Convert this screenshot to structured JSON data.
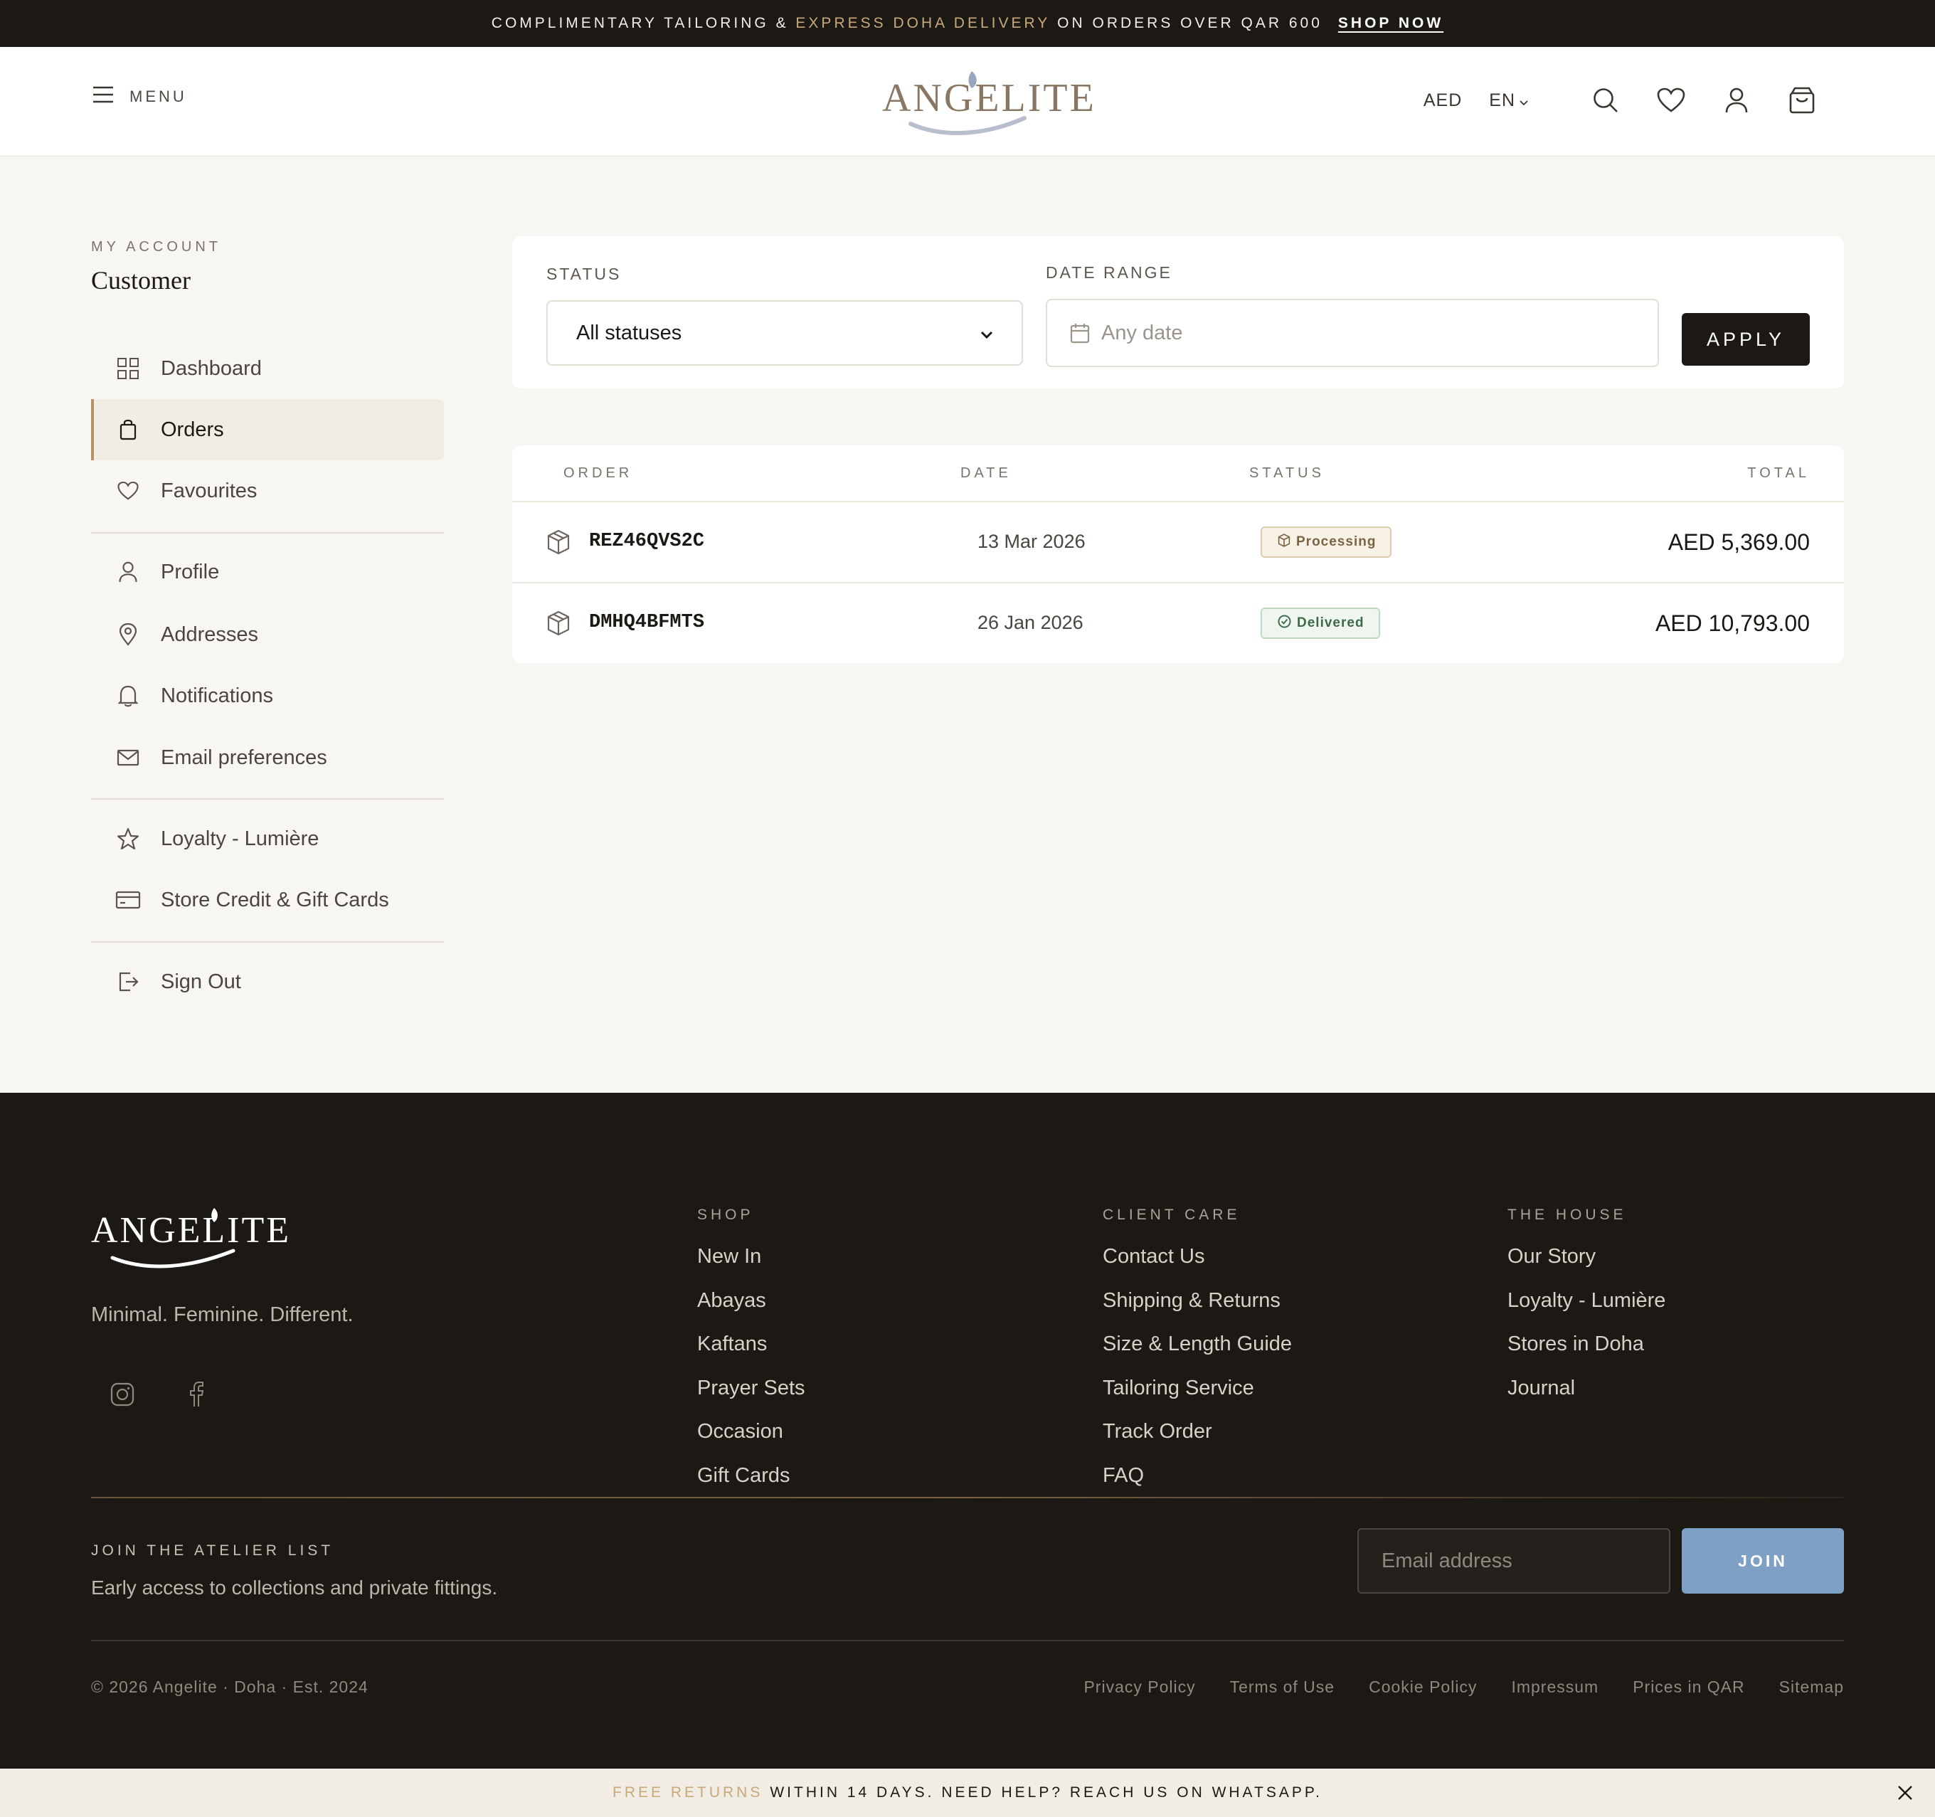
{
  "announcement": {
    "text_before": "COMPLIMENTARY TAILORING & ",
    "highlight": "EXPRESS DOHA DELIVERY",
    "text_after": " ON ORDERS OVER QAR 600",
    "cta": "SHOP NOW"
  },
  "header": {
    "menu_label": "MENU",
    "brand": "ANGELITE",
    "currency": "AED",
    "language": "EN",
    "icons": [
      "search-icon",
      "heart-icon",
      "user-icon",
      "bag-icon"
    ]
  },
  "sidebar": {
    "section_label": "MY ACCOUNT",
    "customer_name": "Customer",
    "items": [
      {
        "label": "Dashboard",
        "icon": "grid-icon"
      },
      {
        "label": "Orders",
        "icon": "bag-icon",
        "active": true
      },
      {
        "label": "Favourites",
        "icon": "heart-icon"
      },
      {
        "label": "Profile",
        "icon": "user-icon"
      },
      {
        "label": "Addresses",
        "icon": "map-pin-icon"
      },
      {
        "label": "Notifications",
        "icon": "bell-icon"
      },
      {
        "label": "Email preferences",
        "icon": "mail-icon"
      },
      {
        "label": "Loyalty - Lumière",
        "icon": "star-icon"
      },
      {
        "label": "Store Credit & Gift Cards",
        "icon": "credit-card-icon"
      },
      {
        "label": "Sign Out",
        "icon": "sign-out-icon"
      }
    ]
  },
  "filters": {
    "status_label": "STATUS",
    "status_value": "All statuses",
    "date_label": "DATE RANGE",
    "date_placeholder": "Any date",
    "apply_label": "APPLY"
  },
  "orders": {
    "columns": [
      "ORDER",
      "DATE",
      "STATUS",
      "TOTAL"
    ],
    "rows": [
      {
        "id": "REZ46QVS2C",
        "date": "13 Mar 2026",
        "status": "Processing",
        "total": "AED 5,369.00"
      },
      {
        "id": "DMHQ4BFMTS",
        "date": "26 Jan 2026",
        "status": "Delivered",
        "total": "AED 10,793.00"
      }
    ]
  },
  "footer": {
    "brand": "ANGELITE",
    "tagline": "Minimal. Feminine. Different.",
    "social_icons": [
      "instagram-icon",
      "facebook-icon"
    ],
    "columns": [
      {
        "title": "SHOP",
        "links": [
          "New In",
          "Abayas",
          "Kaftans",
          "Prayer Sets",
          "Occasion",
          "Gift Cards"
        ]
      },
      {
        "title": "CLIENT CARE",
        "links": [
          "Contact Us",
          "Shipping & Returns",
          "Size & Length Guide",
          "Tailoring Service",
          "Track Order",
          "FAQ"
        ]
      },
      {
        "title": "THE HOUSE",
        "links": [
          "Our Story",
          "Loyalty - Lumière",
          "Stores in Doha",
          "Journal"
        ]
      }
    ],
    "newsletter": {
      "title": "JOIN THE ATELIER LIST",
      "subtitle": "Early access to collections and private fittings.",
      "placeholder": "Email address",
      "button": "JOIN"
    },
    "copyright": "© 2026 Angelite · Doha · Est. 2024",
    "legal_links": [
      "Privacy Policy",
      "Terms of Use",
      "Cookie Policy",
      "Impressum",
      "Prices in QAR",
      "Sitemap"
    ]
  },
  "bottom_bar": {
    "highlight": "FREE RETURNS",
    "text": "WITHIN 14 DAYS. NEED HELP? REACH US ON WHATSAPP."
  },
  "colors": {
    "dark": "#1c1915",
    "accent_gold": "#b89166",
    "join_blue": "#7ea0c4"
  }
}
